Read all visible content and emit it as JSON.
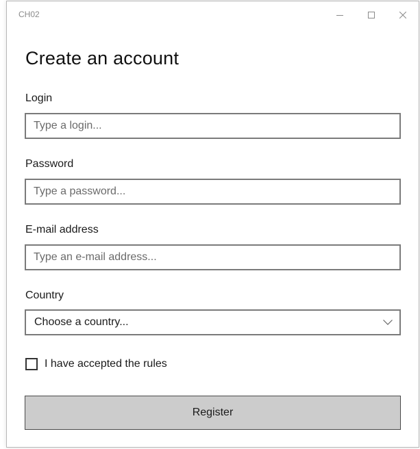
{
  "window": {
    "title": "CH02",
    "controls": [
      "minimize-icon",
      "maximize-icon",
      "close-icon"
    ]
  },
  "form": {
    "heading": "Create an account",
    "login": {
      "label": "Login",
      "placeholder": "Type a login..."
    },
    "password": {
      "label": "Password",
      "placeholder": "Type a password..."
    },
    "email": {
      "label": "E-mail address",
      "placeholder": "Type an e-mail address..."
    },
    "country": {
      "label": "Country",
      "selected": "Choose a country...",
      "icon": "chevron-down-icon"
    },
    "rules": {
      "label": "I have accepted the rules",
      "checked": false
    },
    "register_label": "Register"
  },
  "colors": {
    "border": "#7a7a7a",
    "button_bg": "#cccccc",
    "title_text": "#8a8a8a"
  }
}
